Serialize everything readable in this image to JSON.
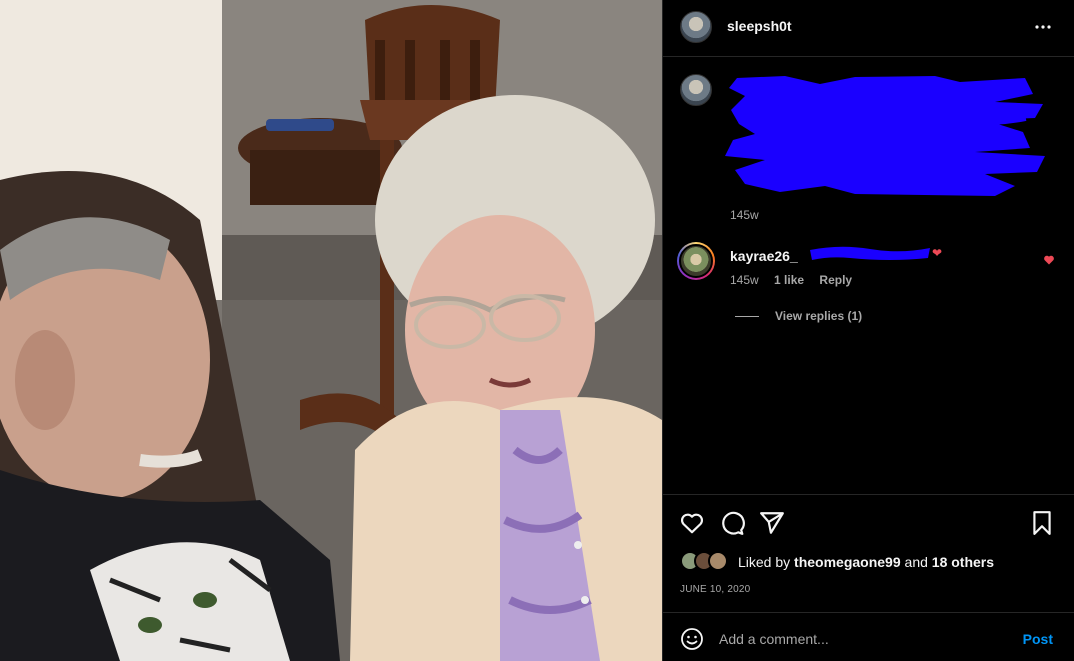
{
  "post": {
    "username": "sleepsh0t",
    "more_icon": "more-horizontal-icon"
  },
  "caption": {
    "time": "145w",
    "redacted": true
  },
  "comment": {
    "username": "kayrae26_",
    "time": "145w",
    "likes": "1 like",
    "reply": "Reply",
    "heart_color": "#ed4956"
  },
  "view_replies": "View replies (1)",
  "actions": {
    "like_icon": "heart-icon",
    "comment_icon": "comment-icon",
    "share_icon": "send-icon",
    "save_icon": "bookmark-icon"
  },
  "likes_summary": {
    "prefix": "Liked by",
    "user": "theomegaone99",
    "joiner": "and",
    "others": "18 others"
  },
  "date": "JUNE 10, 2020",
  "add_comment": {
    "placeholder": "Add a comment...",
    "post_label": "Post",
    "post_color": "#0095f6"
  },
  "colors": {
    "background": "#000000",
    "text": "#f5f5f5",
    "secondary_text": "#a8a8a8",
    "redaction": "#1a00ff"
  }
}
